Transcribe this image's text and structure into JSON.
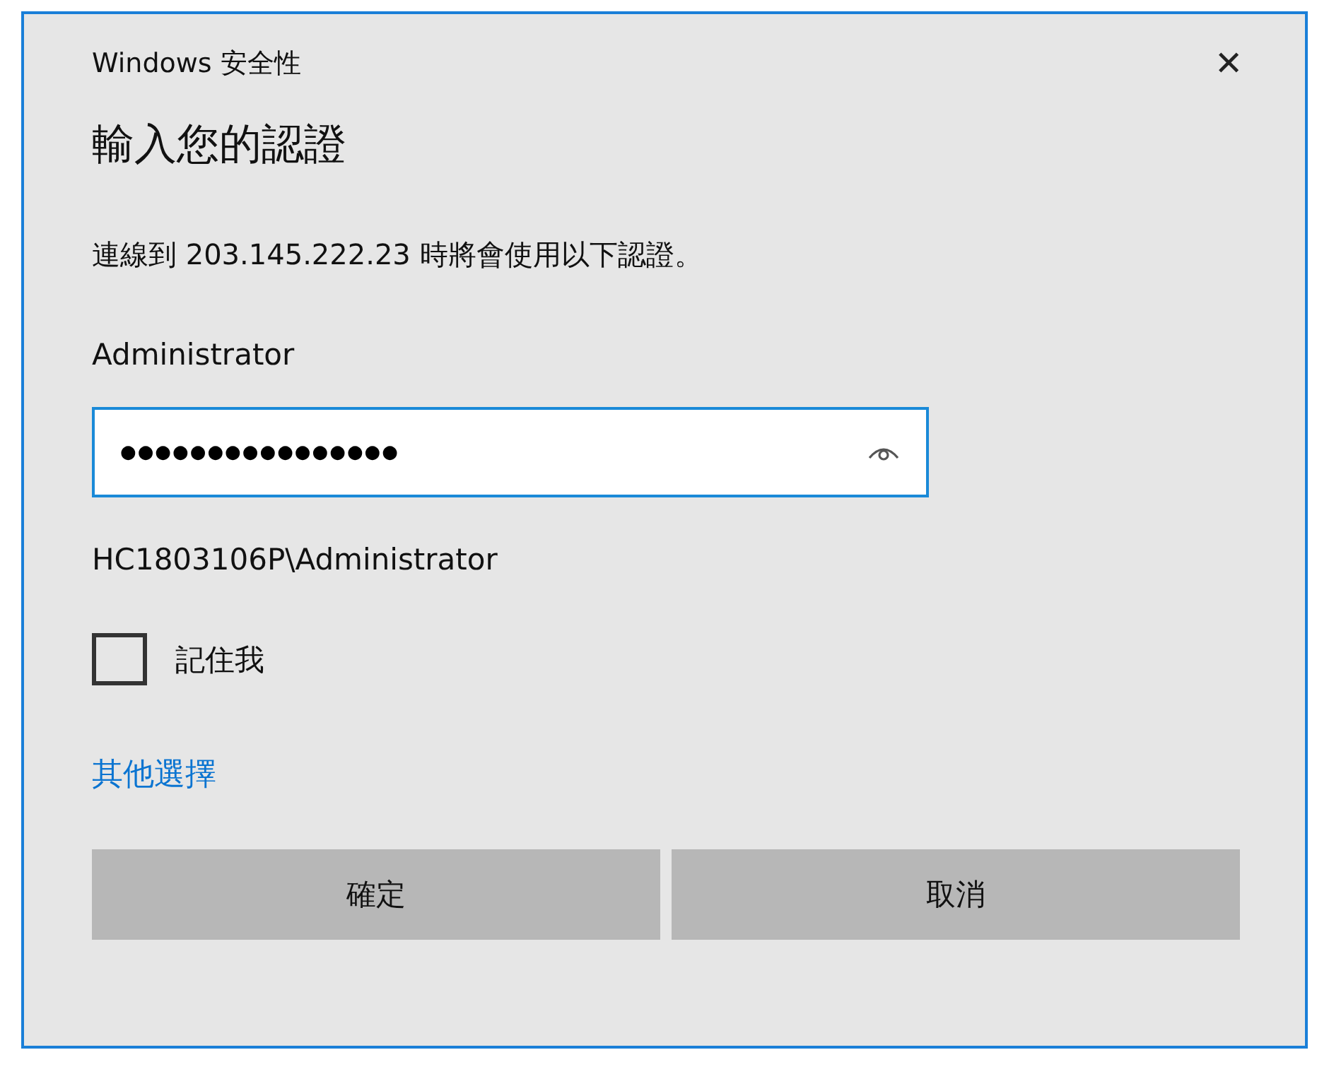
{
  "window": {
    "title": "Windows 安全性",
    "close": "✕"
  },
  "heading": "輸入您的認證",
  "message": "連線到 203.145.222.23 時將會使用以下認證。",
  "username": "Administrator",
  "password_field": {
    "value": "●●●●●●●●●●●●●●●●",
    "focused": true
  },
  "account": "HC1803106P\\Administrator",
  "remember": {
    "label": "記住我",
    "checked": false
  },
  "more_choices_link": "其他選擇",
  "buttons": [
    {
      "label": "確定"
    },
    {
      "label": "取消"
    }
  ]
}
